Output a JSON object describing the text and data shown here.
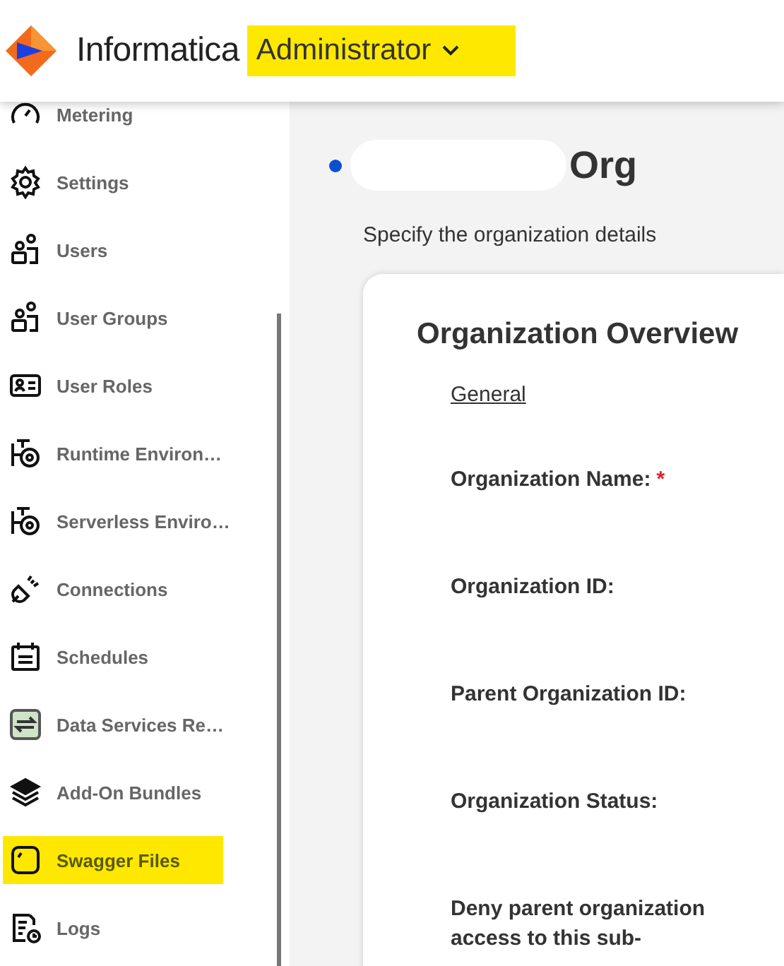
{
  "header": {
    "brand": "Informatica",
    "app_switcher": {
      "label": "Administrator",
      "highlighted": true
    }
  },
  "sidebar": {
    "items": [
      {
        "label": "Metering",
        "highlighted": false
      },
      {
        "label": "Settings",
        "highlighted": false
      },
      {
        "label": "Users",
        "highlighted": false
      },
      {
        "label": "User Groups",
        "highlighted": false
      },
      {
        "label": "User Roles",
        "highlighted": false
      },
      {
        "label": "Runtime Environ…",
        "highlighted": false
      },
      {
        "label": "Serverless Enviro…",
        "highlighted": false
      },
      {
        "label": "Connections",
        "highlighted": false
      },
      {
        "label": "Schedules",
        "highlighted": false
      },
      {
        "label": "Data Services Re…",
        "highlighted": false
      },
      {
        "label": "Add-On Bundles",
        "highlighted": false
      },
      {
        "label": "Swagger Files",
        "highlighted": true
      },
      {
        "label": "Logs",
        "highlighted": false
      }
    ]
  },
  "page": {
    "title": "Org",
    "subtitle": "Specify the organization details",
    "card": {
      "title": "Organization Overview",
      "section": "General",
      "fields": [
        {
          "label": "Organization Name:",
          "required_mark": "*"
        },
        {
          "label": "Organization ID:"
        },
        {
          "label": "Parent Organization ID:"
        },
        {
          "label": "Organization Status:"
        },
        {
          "label": "Deny parent organization access to this sub-"
        }
      ]
    }
  }
}
